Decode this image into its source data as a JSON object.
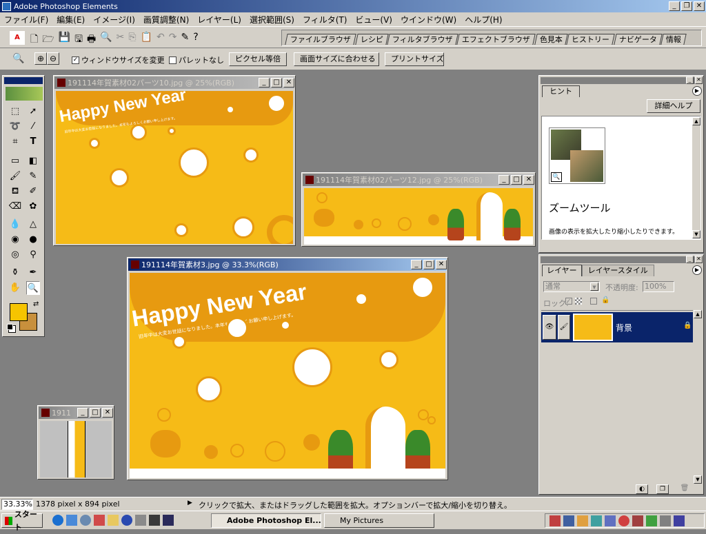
{
  "app": {
    "title": "Adobe Photoshop Elements"
  },
  "menu": [
    "ファイル(F)",
    "編集(E)",
    "イメージ(I)",
    "画質調整(N)",
    "レイヤー(L)",
    "選択範囲(S)",
    "フィルタ(T)",
    "ビュー(V)",
    "ウインドウ(W)",
    "ヘルプ(H)"
  ],
  "palette_tabs": [
    "ファイルブラウザ",
    "レシピ",
    "フィルタブラウザ",
    "エフェクトブラウザ",
    "色見本",
    "ヒストリー",
    "ナビゲータ",
    "情報"
  ],
  "options": {
    "resize_window": "ウィンドウサイズを変更",
    "no_palette": "パレットなし",
    "actual_pixels": "ピクセル等倍",
    "fit_screen": "画面サイズに合わせる",
    "print_size": "プリントサイズ"
  },
  "docs": {
    "doc1": {
      "title": "191114年賀素材02パーツ10.jpg @ 25%(RGB)"
    },
    "doc2": {
      "title": "191114年賀素材02パーツ12.jpg @ 25%(RGB)"
    },
    "doc3": {
      "title": "191114年賀素材3.jpg @ 33.3%(RGB)"
    },
    "doc4": {
      "title": "1911"
    }
  },
  "artwork": {
    "headline": "Happy New Year",
    "greeting": "旧年中は大変お世話になりました。本年もよろしくお願い申し上げます。"
  },
  "hint": {
    "tab": "ヒント",
    "more_help": "詳細ヘルプ",
    "tool_name": "ズームツール",
    "description": "画像の表示を拡大したり縮小したりできます。"
  },
  "layers": {
    "tabs": [
      "レイヤー",
      "レイヤースタイル"
    ],
    "blend_mode": "通常",
    "opacity_label": "不透明度:",
    "opacity": "100%",
    "lock_label": "ロック:",
    "layer_name": "背景"
  },
  "status": {
    "zoom": "33.33%",
    "size": "1378 pixel x 894 pixel",
    "message": "クリックで拡大、またはドラッグした範囲を拡大。オプションバーで拡大/縮小を切り替え。"
  },
  "taskbar": {
    "start": "スタート",
    "tasks": [
      "Adobe Photoshop El...",
      "My Pictures"
    ]
  },
  "colors": {
    "accent": "#0a246a",
    "orange": "#f6bb17",
    "dark_orange": "#e79a10"
  }
}
